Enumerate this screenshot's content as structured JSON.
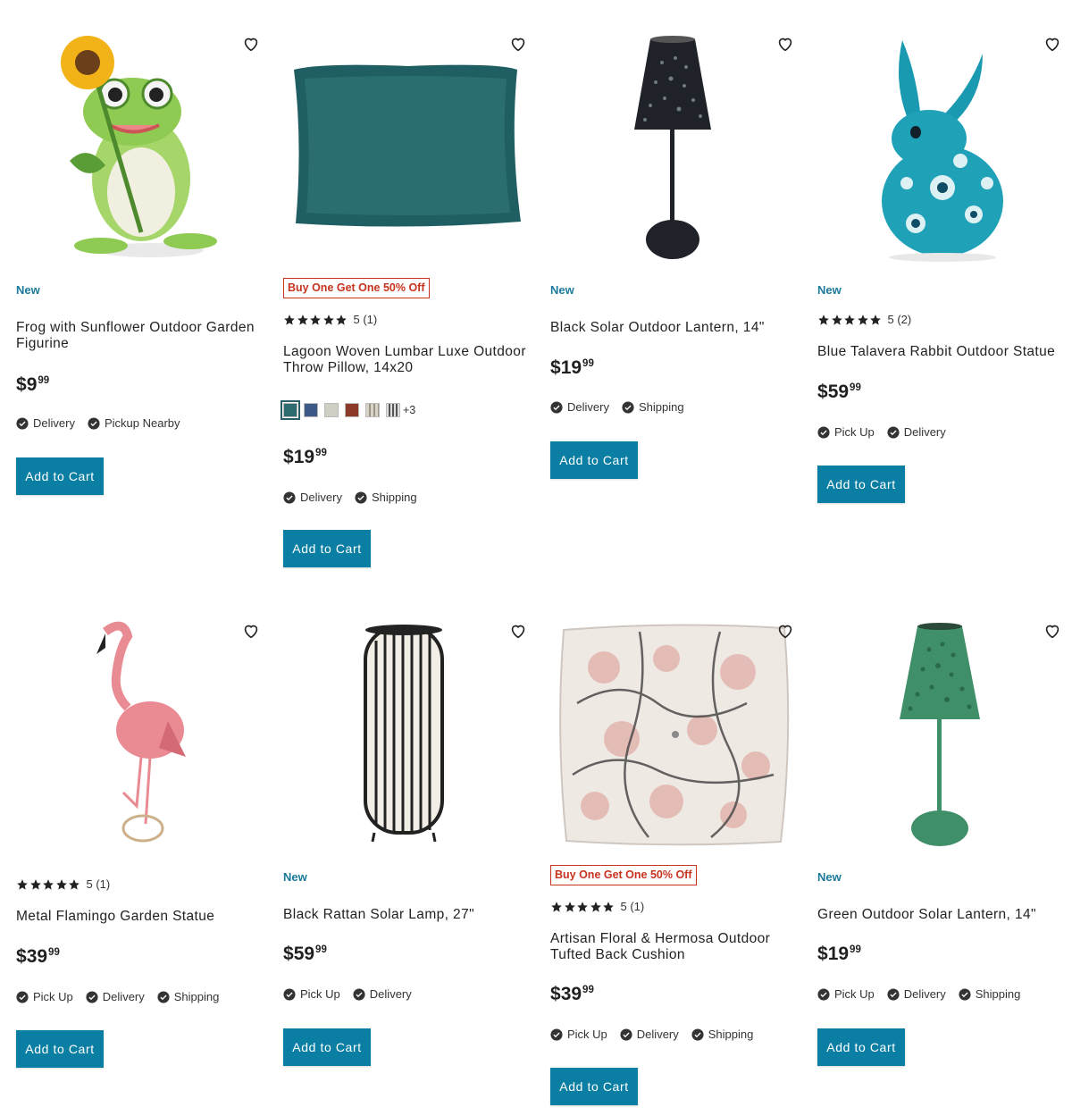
{
  "products": [
    {
      "id": "frog",
      "badge_new": "New",
      "title_line1": "Frog with Sunflower Outdoor Garden",
      "title_line2": "Figurine",
      "price": {
        "currency": "$",
        "whole": "9",
        "cents": "99"
      },
      "fulfillment": [
        "Delivery",
        "Pickup Nearby"
      ],
      "cta": "Add to Cart"
    },
    {
      "id": "pillow",
      "promo": "Buy One Get One 50% Off",
      "rating": {
        "stars": 5,
        "text": "5 (1)"
      },
      "title_line1": "Lagoon Woven Lumbar Luxe Outdoor",
      "title_line2": "Throw Pillow, 14x20",
      "swatches": {
        "colors": [
          "#2d6b6e",
          "#3c5a85",
          "#cfcfc4",
          "#8b3a28",
          "#d9d3c7",
          "#777777"
        ],
        "more": "+3"
      },
      "price": {
        "currency": "$",
        "whole": "19",
        "cents": "99"
      },
      "fulfillment": [
        "Delivery",
        "Shipping"
      ],
      "cta": "Add to Cart"
    },
    {
      "id": "black-lantern",
      "badge_new": "New",
      "title_line1": "Black Solar Outdoor Lantern, 14\"",
      "price": {
        "currency": "$",
        "whole": "19",
        "cents": "99"
      },
      "fulfillment": [
        "Delivery",
        "Shipping"
      ],
      "cta": "Add to Cart"
    },
    {
      "id": "rabbit",
      "badge_new": "New",
      "rating": {
        "stars": 5,
        "text": "5 (2)"
      },
      "title_line1": "Blue Talavera Rabbit Outdoor Statue",
      "price": {
        "currency": "$",
        "whole": "59",
        "cents": "99"
      },
      "fulfillment": [
        "Pick Up",
        "Delivery"
      ],
      "cta": "Add to Cart"
    },
    {
      "id": "flamingo",
      "rating": {
        "stars": 5,
        "text": "5 (1)"
      },
      "title_line1": "Metal Flamingo Garden Statue",
      "price": {
        "currency": "$",
        "whole": "39",
        "cents": "99"
      },
      "fulfillment": [
        "Pick Up",
        "Delivery",
        "Shipping"
      ],
      "cta": "Add to Cart"
    },
    {
      "id": "rattan-lamp",
      "badge_new": "New",
      "title_line1": "Black Rattan Solar Lamp, 27\"",
      "price": {
        "currency": "$",
        "whole": "59",
        "cents": "99"
      },
      "fulfillment": [
        "Pick Up",
        "Delivery"
      ],
      "cta": "Add to Cart"
    },
    {
      "id": "cushion",
      "promo": "Buy One Get One 50% Off",
      "rating": {
        "stars": 5,
        "text": "5 (1)"
      },
      "title_line1": "Artisan Floral & Hermosa Outdoor",
      "title_line2": "Tufted Back Cushion",
      "price": {
        "currency": "$",
        "whole": "39",
        "cents": "99"
      },
      "fulfillment": [
        "Pick Up",
        "Delivery",
        "Shipping"
      ],
      "cta": "Add to Cart"
    },
    {
      "id": "green-lantern",
      "badge_new": "New",
      "title_line1": "Green Outdoor Solar Lantern, 14\"",
      "price": {
        "currency": "$",
        "whole": "19",
        "cents": "99"
      },
      "fulfillment": [
        "Pick Up",
        "Delivery",
        "Shipping"
      ],
      "cta": "Add to Cart"
    }
  ],
  "icons": {
    "wishlist": "heart-outline-icon",
    "fulfillment": "check-circle-icon",
    "rating": "star-icon"
  },
  "colors": {
    "cta": "#0b7ea3",
    "new_badge": "#1b7a99",
    "promo": "#c8331f"
  }
}
